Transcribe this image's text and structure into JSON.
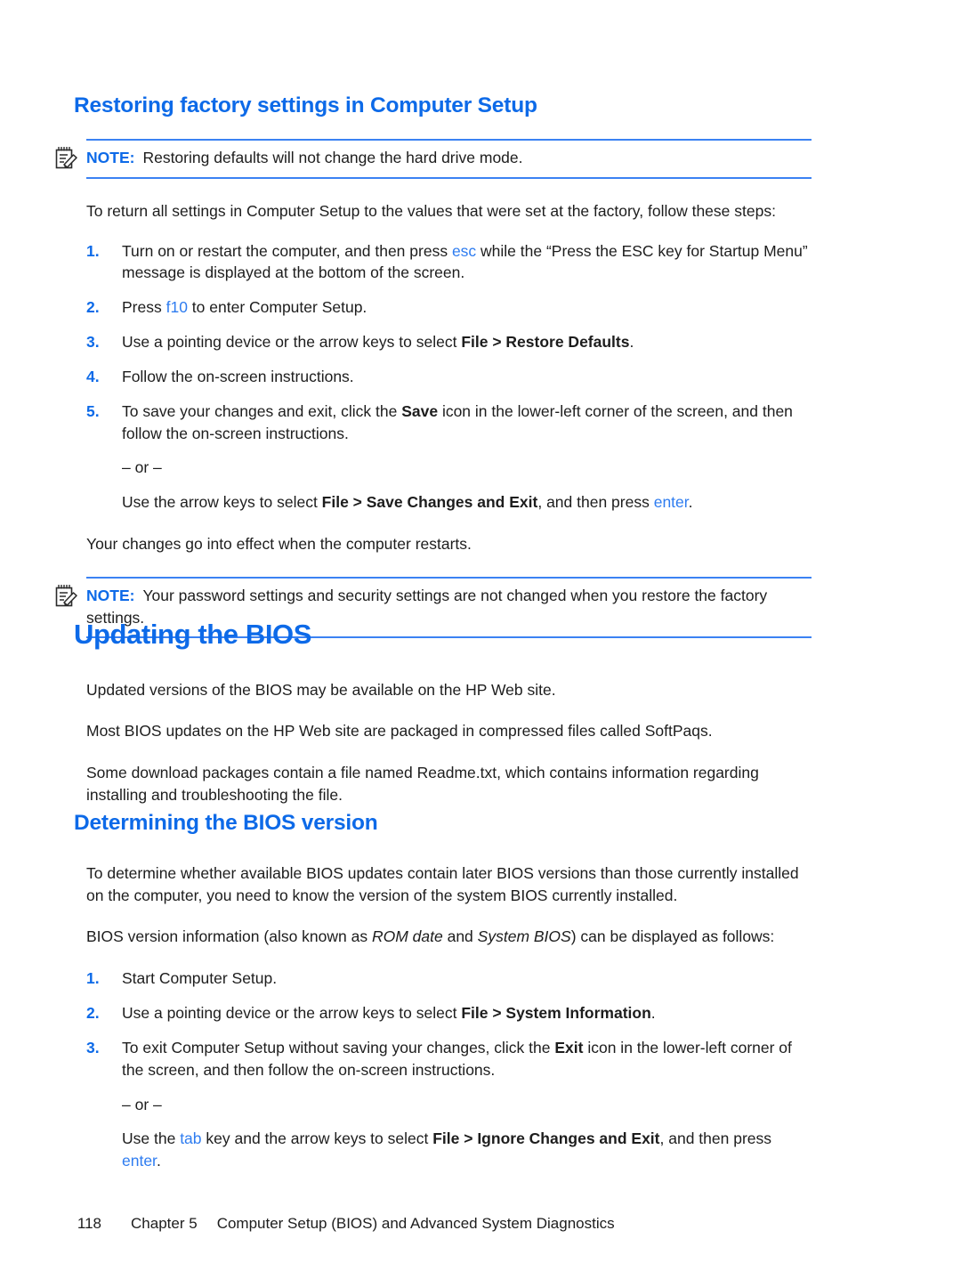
{
  "colors": {
    "heading_blue": "#0d6ae8",
    "key_blue": "#2e7cf0",
    "rule_blue": "#3b82f3",
    "body_black": "#1d1d1d"
  },
  "sections": {
    "restoring": {
      "heading": "Restoring factory settings in Computer Setup",
      "note1": {
        "icon": "note-pad-pencil-icon",
        "label": "NOTE:",
        "text": "Restoring defaults will not change the hard drive mode."
      },
      "intro": "To return all settings in Computer Setup to the values that were set at the factory, follow these steps:",
      "steps": [
        {
          "num": "1.",
          "a": "Turn on or restart the computer, and then press ",
          "key": "esc",
          "b": " while the “Press the ESC key for Startup Menu” message is displayed at the bottom of the screen."
        },
        {
          "num": "2.",
          "a": "Press ",
          "key": "f10",
          "b": " to enter Computer Setup."
        },
        {
          "num": "3.",
          "a": "Use a pointing device or the arrow keys to select ",
          "bold": "File > Restore Defaults",
          "b": "."
        },
        {
          "num": "4.",
          "a": "Follow the on-screen instructions.",
          "bold": "",
          "b": ""
        },
        {
          "num": "5.",
          "a": "To save your changes and exit, click the ",
          "bold": "Save",
          "b": " icon in the lower-left corner of the screen, and then follow the on-screen instructions.",
          "or": "– or –",
          "alt_a": "Use the arrow keys to select ",
          "alt_bold": "File > Save Changes and Exit",
          "alt_b": ", and then press ",
          "alt_key": "enter",
          "alt_c": "."
        }
      ],
      "after_steps": "Your changes go into effect when the computer restarts.",
      "note2": {
        "icon": "note-pad-pencil-icon",
        "label": "NOTE:",
        "text": "Your password settings and security settings are not changed when you restore the factory settings."
      }
    },
    "updating": {
      "heading": "Updating the BIOS",
      "paragraphs": [
        "Updated versions of the BIOS may be available on the HP Web site.",
        "Most BIOS updates on the HP Web site are packaged in compressed files called SoftPaqs.",
        "Some download packages contain a file named Readme.txt, which contains information regarding installing and troubleshooting the file."
      ]
    },
    "determining": {
      "heading": "Determining the BIOS version",
      "paragraph1": "To determine whether available BIOS updates contain later BIOS versions than those currently installed on the computer, you need to know the version of the system BIOS currently installed.",
      "paragraph2": {
        "a": "BIOS version information (also known as ",
        "ital1": "ROM date",
        "b": " and ",
        "ital2": "System BIOS",
        "c": ") can be displayed as follows:"
      },
      "steps": [
        {
          "num": "1.",
          "a": "Start Computer Setup.",
          "bold": "",
          "b": ""
        },
        {
          "num": "2.",
          "a": "Use a pointing device or the arrow keys to select ",
          "bold": "File > System Information",
          "b": "."
        },
        {
          "num": "3.",
          "a": "To exit Computer Setup without saving your changes, click the ",
          "bold": "Exit",
          "b": " icon in the lower-left corner of the screen, and then follow the on-screen instructions.",
          "or": "– or –",
          "alt_a": "Use the ",
          "alt_key1": "tab",
          "alt_b": " key and the arrow keys to select ",
          "alt_bold": "File > Ignore Changes and Exit",
          "alt_c": ", and then press ",
          "alt_key2": "enter",
          "alt_d": "."
        }
      ]
    }
  },
  "footer": {
    "page_number": "118",
    "chapter": "Chapter 5",
    "title": "Computer Setup (BIOS) and Advanced System Diagnostics"
  }
}
